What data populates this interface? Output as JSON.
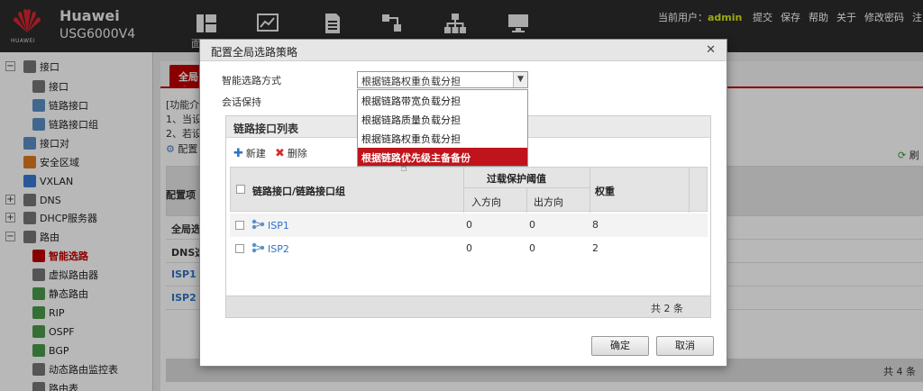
{
  "header": {
    "brand": "Huawei",
    "model": "USG6000V4",
    "logo_text": "HUAWEI",
    "nav_partial_label": "面",
    "current_user_label": "当前用户：",
    "username": "admin",
    "actions": [
      "提交",
      "保存",
      "帮助",
      "关于",
      "修改密码",
      "注"
    ]
  },
  "tree": {
    "items": [
      {
        "label": "接口",
        "icon": "interface-icon"
      },
      {
        "label": "接口",
        "icon": "interface-icon"
      },
      {
        "label": "链路接口",
        "icon": "link-interface-icon"
      },
      {
        "label": "链路接口组",
        "icon": "link-group-icon"
      },
      {
        "label": "接口对",
        "icon": "interface-pair-icon"
      },
      {
        "label": "安全区域",
        "icon": "security-zone-icon"
      },
      {
        "label": "VXLAN",
        "icon": "vxlan-icon"
      },
      {
        "label": "DNS",
        "icon": "dns-icon"
      },
      {
        "label": "DHCP服务器",
        "icon": "dhcp-icon"
      },
      {
        "label": "路由",
        "icon": "route-icon"
      },
      {
        "label": "智能选路",
        "icon": "smart-route-icon"
      },
      {
        "label": "虚拟路由器",
        "icon": "virtual-router-icon"
      },
      {
        "label": "静态路由",
        "icon": "static-route-icon"
      },
      {
        "label": "RIP",
        "icon": "rip-icon"
      },
      {
        "label": "OSPF",
        "icon": "ospf-icon"
      },
      {
        "label": "BGP",
        "icon": "bgp-icon"
      },
      {
        "label": "动态路由监控表",
        "icon": "monitor-icon"
      },
      {
        "label": "路由表",
        "icon": "route-table-icon"
      }
    ]
  },
  "background": {
    "tab_label": "全局选",
    "func_intro": "[功能介",
    "line1": "1、当设",
    "line2": "2、若设",
    "cfg_label": "配置",
    "refresh_label": "刷",
    "col_header": "配置项",
    "rows": [
      "全局选",
      "DNS选",
      "ISP1",
      "ISP2"
    ],
    "total": "共 4 条"
  },
  "dialog": {
    "title": "配置全局选路策略",
    "mode_label": "智能选路方式",
    "session_label": "会话保持",
    "selected_value": "根据链路权重负载分担",
    "options": [
      "根据链路带宽负载分担",
      "根据链路质量负载分担",
      "根据链路权重负载分担",
      "根据链路优先级主备备份"
    ],
    "highlighted_option_index": 3,
    "list": {
      "title": "链路接口列表",
      "new_label": "新建",
      "delete_label": "删除",
      "col_name": "链路接口/链路接口组",
      "col_threshold": "过载保护阈值",
      "col_in": "入方向",
      "col_out": "出方向",
      "col_weight": "权重",
      "rows": [
        {
          "name": "ISP1",
          "in": "0",
          "out": "0",
          "weight": "8"
        },
        {
          "name": "ISP2",
          "in": "0",
          "out": "0",
          "weight": "2"
        }
      ],
      "total": "共 2 条"
    },
    "ok_label": "确定",
    "cancel_label": "取消"
  },
  "colors": {
    "accent": "#c00000",
    "link": "#2b73c8",
    "header_bg": "#2b2b2b",
    "username": "#d8e81a"
  }
}
